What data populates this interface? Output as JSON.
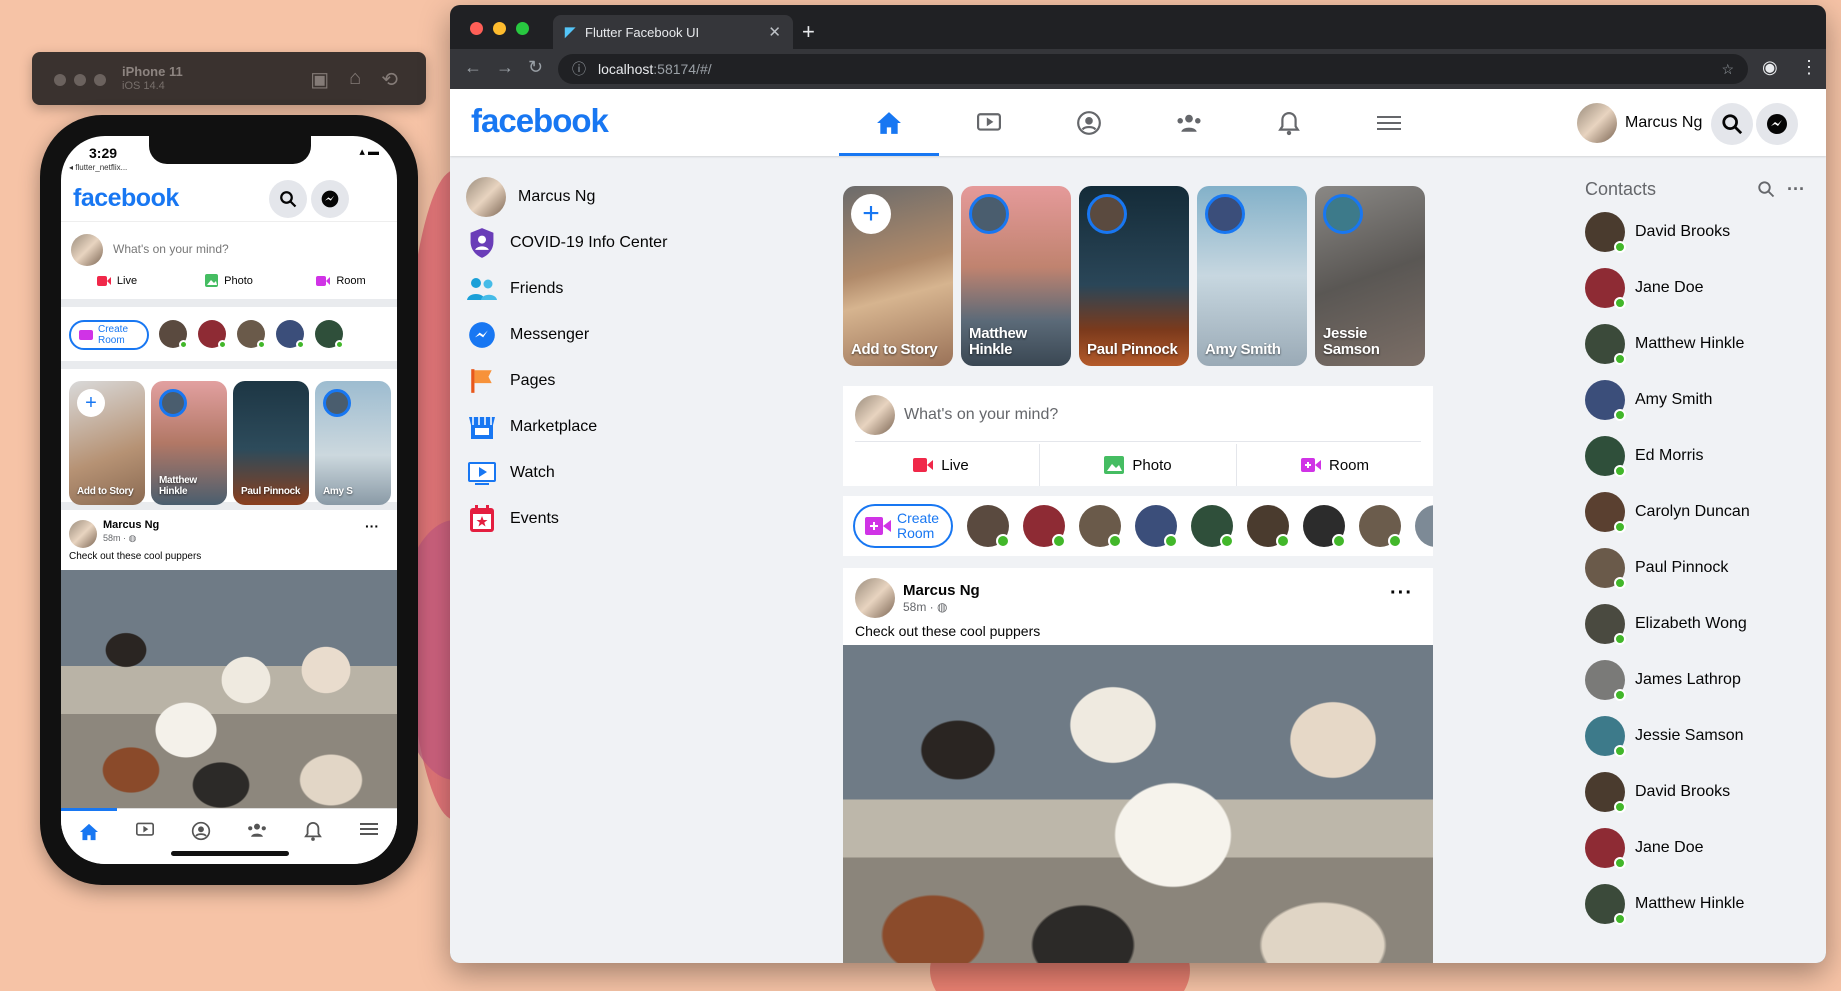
{
  "simulator": {
    "device": "iPhone 11",
    "os": "iOS 14.4"
  },
  "phone": {
    "time": "3:29",
    "back_label": "◂ flutter_netflix...",
    "logo": "facebook",
    "compose_placeholder": "What's on your mind?",
    "actions": [
      "Live",
      "Photo",
      "Room"
    ],
    "create_room": "Create Room",
    "stories": [
      "Add to Story",
      "Matthew Hinkle",
      "Paul Pinnock",
      "Amy S"
    ],
    "post": {
      "author": "Marcus Ng",
      "meta": "58m · ",
      "caption": "Check out these cool puppers"
    }
  },
  "browser": {
    "tab_title": "Flutter Facebook UI",
    "url_host": "localhost",
    "url_rest": ":58174/#/"
  },
  "header": {
    "logo": "facebook",
    "user_name": "Marcus Ng"
  },
  "left_nav": [
    {
      "label": "Marcus Ng",
      "icon": "avatar"
    },
    {
      "label": "COVID-19 Info Center",
      "icon": "shield-icon"
    },
    {
      "label": "Friends",
      "icon": "friends-icon"
    },
    {
      "label": "Messenger",
      "icon": "messenger-icon"
    },
    {
      "label": "Pages",
      "icon": "flag-icon"
    },
    {
      "label": "Marketplace",
      "icon": "store-icon"
    },
    {
      "label": "Watch",
      "icon": "video-icon"
    },
    {
      "label": "Events",
      "icon": "calendar-icon"
    }
  ],
  "stories": [
    {
      "label": "Add to Story",
      "bg": "#b59a7f"
    },
    {
      "label": "Matthew Hinkle",
      "bg": "#c88a6d"
    },
    {
      "label": "Paul Pinnock",
      "bg": "#1f3a4a"
    },
    {
      "label": "Amy Smith",
      "bg": "#8fb0c4"
    },
    {
      "label": "Jessie Samson",
      "bg": "#6d6a67"
    }
  ],
  "compose": {
    "placeholder": "What's on your mind?",
    "actions": [
      "Live",
      "Photo",
      "Room"
    ]
  },
  "create_room": {
    "line1": "Create",
    "line2": "Room"
  },
  "post": {
    "author": "Marcus Ng",
    "meta": "58m · ",
    "caption": "Check out these cool puppers"
  },
  "contacts": {
    "title": "Contacts",
    "items": [
      "David Brooks",
      "Jane Doe",
      "Matthew Hinkle",
      "Amy Smith",
      "Ed Morris",
      "Carolyn Duncan",
      "Paul Pinnock",
      "Elizabeth Wong",
      "James Lathrop",
      "Jessie Samson",
      "David Brooks",
      "Jane Doe",
      "Matthew Hinkle"
    ]
  },
  "colors": {
    "brand": "#1877f2",
    "online": "#42b72a",
    "live": "#f02849",
    "photo": "#45bd62",
    "room": "#d033e6"
  }
}
